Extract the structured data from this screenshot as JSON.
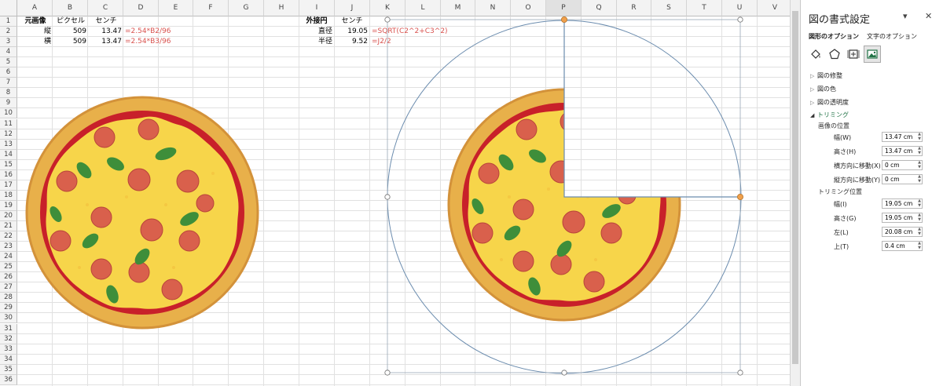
{
  "columns": [
    "A",
    "B",
    "C",
    "D",
    "E",
    "F",
    "G",
    "H",
    "I",
    "J",
    "K",
    "L",
    "M",
    "N",
    "O",
    "P",
    "Q",
    "R",
    "S",
    "T",
    "U",
    "V"
  ],
  "rows": [
    "1",
    "2",
    "3",
    "4",
    "5",
    "6",
    "7",
    "8",
    "9",
    "10",
    "11",
    "12",
    "13",
    "14",
    "15",
    "16",
    "17",
    "18",
    "19",
    "20",
    "21",
    "22",
    "23",
    "24",
    "25",
    "26",
    "27",
    "28",
    "29",
    "30",
    "31",
    "32",
    "33",
    "34",
    "35",
    "36"
  ],
  "cells": {
    "A1": "元画像",
    "B1": "ピクセル",
    "C1": "センチ",
    "A2": "縦",
    "B2": "509",
    "C2": "13.47",
    "D2": "=2.54*B2/96",
    "A3": "横",
    "B3": "509",
    "C3": "13.47",
    "D3": "=2.54*B3/96",
    "I1": "外接円",
    "J1": "センチ",
    "I2": "直径",
    "J2": "19.05",
    "K2": "=SQRT(C2^2+C3^2)",
    "I3": "半径",
    "J3": "9.52",
    "K3": "=J2/2"
  },
  "colors": {
    "formula_text": "#d9534f",
    "pizza_crust": "#e8b04a",
    "pizza_sauce": "#c8202a",
    "pizza_cheese": "#f7d54a",
    "pepperoni": "#d9604c",
    "basil": "#3e8e3a",
    "selection_outline": "#6b8cae",
    "handle": "#f0a04b",
    "accent_green": "#217346"
  },
  "panel": {
    "title": "図の書式設定",
    "dropdown_icon": "chevron-down-icon",
    "close_icon": "close-icon",
    "tabs": [
      "図形のオプション",
      "文字のオプション"
    ],
    "icons": [
      "fill-line-icon",
      "effects-pentagon-icon",
      "size-properties-icon",
      "picture-icon"
    ],
    "sections": [
      "図の修整",
      "図の色",
      "図の透明度",
      "トリミング"
    ],
    "image_position_heading": "画像の位置",
    "crop_position_heading": "トリミング位置",
    "fields": [
      {
        "label": "幅(W)",
        "value": "13.47 cm"
      },
      {
        "label": "高さ(H)",
        "value": "13.47 cm"
      },
      {
        "label": "横方向に移動(X)",
        "value": "0 cm"
      },
      {
        "label": "縦方向に移動(Y)",
        "value": "0 cm"
      },
      {
        "label": "幅(I)",
        "value": "19.05 cm"
      },
      {
        "label": "高さ(G)",
        "value": "19.05 cm"
      },
      {
        "label": "左(L)",
        "value": "20.08 cm"
      },
      {
        "label": "上(T)",
        "value": "0.4 cm"
      }
    ]
  }
}
